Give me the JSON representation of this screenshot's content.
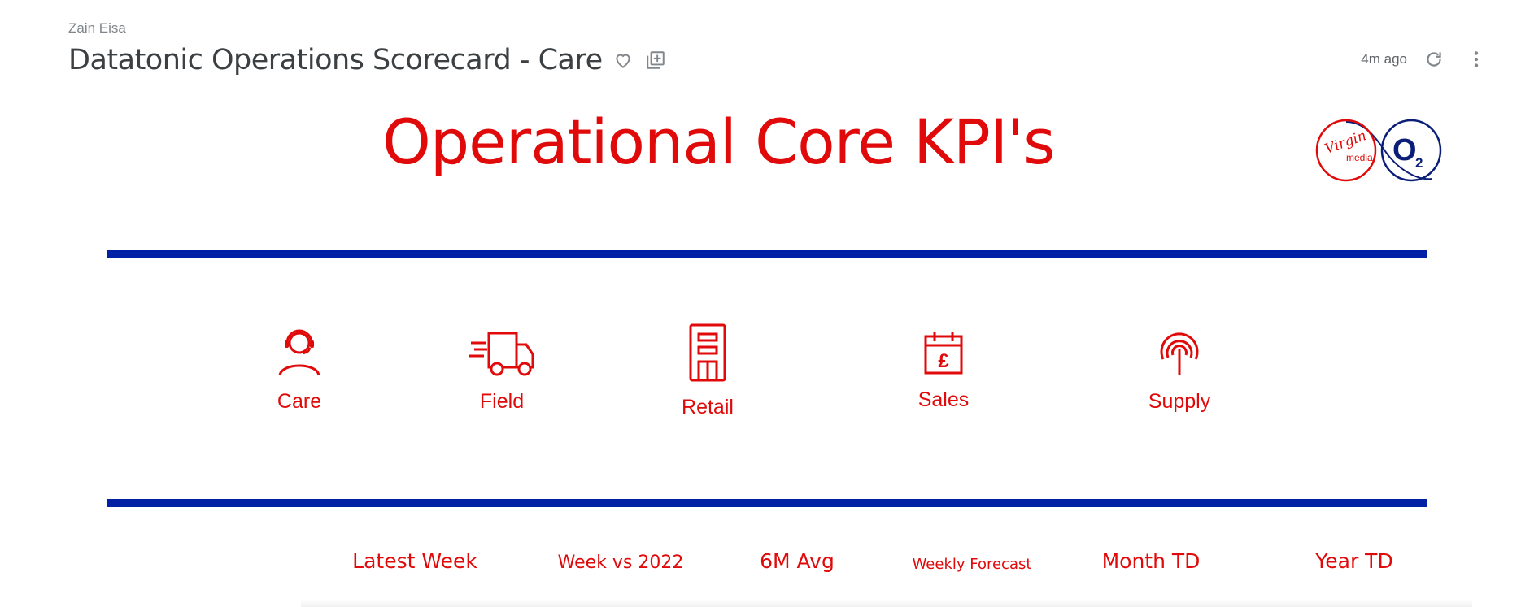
{
  "header": {
    "author": "Zain Eisa",
    "title": "Datatonic Operations Scorecard - Care",
    "updated": "4m ago",
    "icons": [
      "heart-icon",
      "add-to-collection-icon",
      "refresh-icon",
      "more-vert-icon"
    ]
  },
  "banner": {
    "title": "Operational Core KPI's",
    "logo_text": {
      "virgin": "Virgin",
      "media": "media",
      "o2": "O",
      "o2_sub": "2"
    }
  },
  "nav": {
    "items": [
      {
        "label": "Care",
        "icon": "headset-agent-icon"
      },
      {
        "label": "Field",
        "icon": "delivery-van-icon"
      },
      {
        "label": "Retail",
        "icon": "store-building-icon"
      },
      {
        "label": "Sales",
        "icon": "calendar-pound-icon"
      },
      {
        "label": "Supply",
        "icon": "signal-antenna-icon"
      }
    ]
  },
  "columns": [
    "Latest Week",
    "Week vs 2022",
    "6M Avg",
    "Weekly Forecast",
    "Month TD",
    "Year TD"
  ],
  "colors": {
    "accent_red": "#e10a0a",
    "rule_blue": "#0021a5",
    "o2_navy": "#0a1e78"
  }
}
